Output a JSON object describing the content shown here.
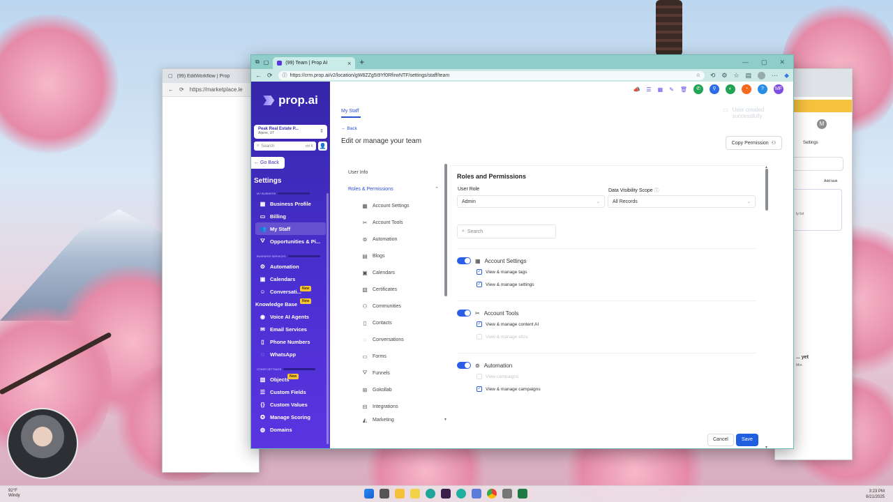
{
  "desktop": {
    "weather": {
      "temp": "92°F",
      "cond": "Windy"
    },
    "clock": {
      "time": "3:23 PM",
      "date": "6/21/2025"
    }
  },
  "back_window": {
    "tab_title": "(99) EditWorkflow | Prop",
    "url": "https://marketplace.le"
  },
  "browser": {
    "tab_title": "(99) Team | Prop AI",
    "url": "https://crm.prop.ai/v2/location/gW8ZZg5I9Yf0RfirwNTF/settings/staff/team"
  },
  "sidebar": {
    "logo": "prop.ai",
    "location_name": "Peak Real Estate P...",
    "location_sub": "Alpine, UT",
    "search_placeholder": "Search",
    "search_shortcut": "ctrl K",
    "go_back": "Go Back",
    "title": "Settings",
    "sections": {
      "my_business": "MY BUSINESS",
      "business_services": "BUSINESS SERVICES",
      "other_settings": "OTHER SETTINGS"
    },
    "items": [
      {
        "label": "Business Profile",
        "icon": "building-icon"
      },
      {
        "label": "Billing",
        "icon": "card-icon"
      },
      {
        "label": "My Staff",
        "icon": "users-icon"
      },
      {
        "label": "Opportunities & Pi...",
        "icon": "filter-icon"
      },
      {
        "label": "Automation",
        "icon": "gear-icon"
      },
      {
        "label": "Calendars",
        "icon": "calendar-icon"
      },
      {
        "label": "Conversati...",
        "icon": "person-icon",
        "badge": "New"
      },
      {
        "label": "Knowledge Base",
        "icon": "",
        "badge": "New"
      },
      {
        "label": "Voice AI Agents",
        "icon": "headset-icon"
      },
      {
        "label": "Email Services",
        "icon": "mail-icon"
      },
      {
        "label": "Phone Numbers",
        "icon": "phone-icon"
      },
      {
        "label": "WhatsApp",
        "icon": "chat-icon"
      },
      {
        "label": "Objects",
        "icon": "cube-icon",
        "badge": "New"
      },
      {
        "label": "Custom Fields",
        "icon": "list-icon"
      },
      {
        "label": "Custom Values",
        "icon": "braces-icon"
      },
      {
        "label": "Manage Scoring",
        "icon": "star-icon"
      },
      {
        "label": "Domains",
        "icon": "globe-icon"
      }
    ]
  },
  "header": {
    "tab": "My Staff",
    "toast": "User created successfully",
    "back": "Back",
    "title": "Edit or manage your team",
    "copy_permission": "Copy Permission",
    "avatar_initials": "MF"
  },
  "subnav": {
    "user_info": "User Info",
    "roles": "Roles & Permissions",
    "items": [
      "Account Settings",
      "Account Tools",
      "Automation",
      "Blogs",
      "Calendars",
      "Certificates",
      "Communities",
      "Contacts",
      "Conversations",
      "Forms",
      "Funnels",
      "Gokollab",
      "Integrations",
      "Marketing"
    ]
  },
  "panel": {
    "title": "Roles and Permissions",
    "user_role_label": "User Role",
    "user_role_value": "Admin",
    "visibility_label": "Data Visibility Scope",
    "visibility_value": "All Records",
    "search_placeholder": "Search",
    "groups": [
      {
        "name": "Account Settings",
        "perms": [
          {
            "label": "View & manage tags",
            "checked": true
          },
          {
            "label": "View & manage settings",
            "checked": true
          }
        ]
      },
      {
        "name": "Account Tools",
        "perms": [
          {
            "label": "View & manage content AI",
            "checked": true
          },
          {
            "label": "View & manage eliza",
            "checked": false
          }
        ]
      },
      {
        "name": "Automation",
        "perms": [
          {
            "label": "View campaigns",
            "checked": false
          },
          {
            "label": "View & manage campaigns",
            "checked": true
          }
        ]
      }
    ],
    "cancel": "Cancel",
    "save": "Save"
  },
  "right_window": {
    "settings": "Settings",
    "add_task": "Add task",
    "list_text": "ty list",
    "yet": "... yet",
    "mor": "Mor.",
    "avatar": "M"
  }
}
